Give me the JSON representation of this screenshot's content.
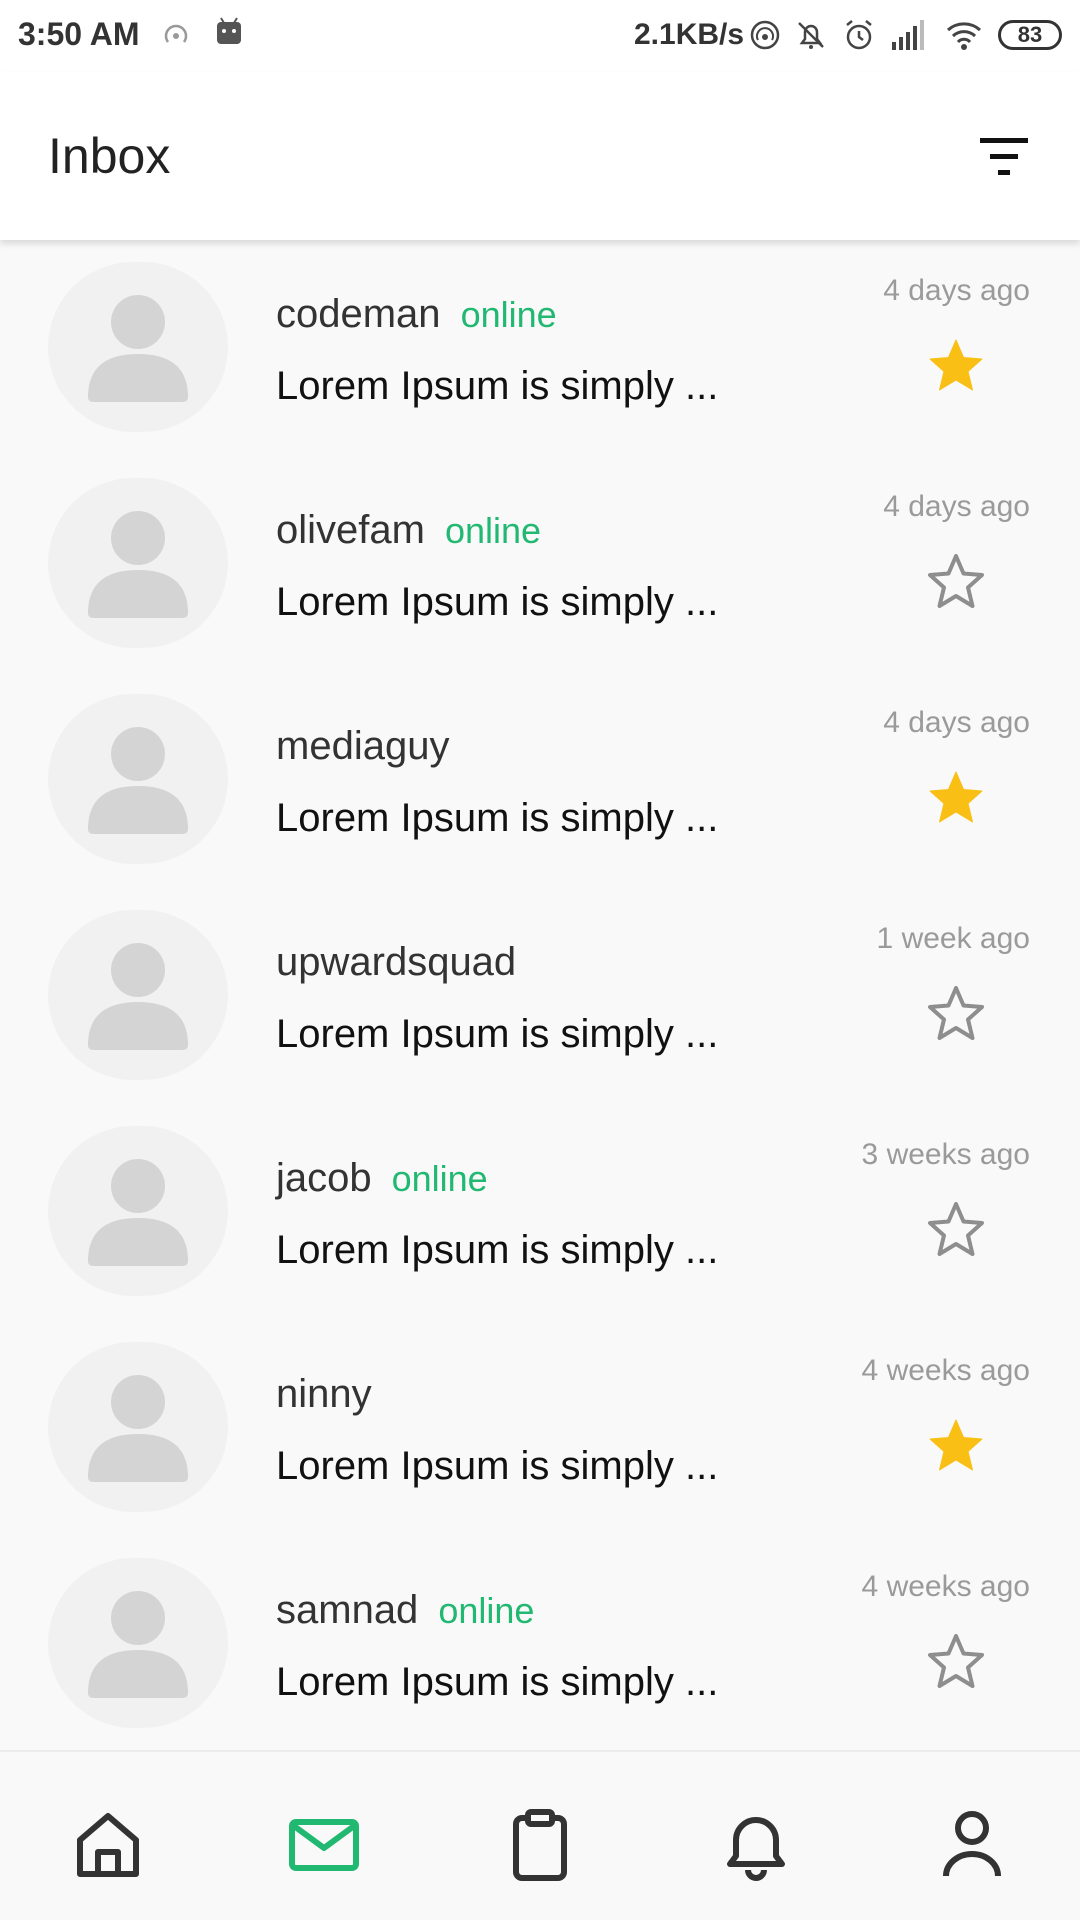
{
  "status_bar": {
    "time": "3:50 AM",
    "network_speed": "2.1KB/s",
    "battery": "83",
    "icons": [
      "hotspot-icon",
      "android-debug-icon",
      "data-sync-icon",
      "mute-icon",
      "alarm-icon",
      "signal-icon",
      "wifi-icon",
      "battery-icon"
    ]
  },
  "header": {
    "title": "Inbox",
    "filter_icon": "filter-icon"
  },
  "colors": {
    "online": "#21b872",
    "star_active": "#f9bf15",
    "star_inactive": "#8e8e8e",
    "nav_active": "#21b872",
    "nav_inactive": "#333333"
  },
  "messages": [
    {
      "username": "codeman",
      "online": "online",
      "preview": "Lorem Ipsum is simply ...",
      "time": "4 days ago",
      "starred": true
    },
    {
      "username": "olivefam",
      "online": "online",
      "preview": "Lorem Ipsum is simply ...",
      "time": "4 days ago",
      "starred": false
    },
    {
      "username": "mediaguy",
      "online": "",
      "preview": "Lorem Ipsum is simply ...",
      "time": "4 days ago",
      "starred": true
    },
    {
      "username": "upwardsquad",
      "online": "",
      "preview": "Lorem Ipsum is simply ...",
      "time": "1 week ago",
      "starred": false
    },
    {
      "username": "jacob",
      "online": "online",
      "preview": "Lorem Ipsum is simply ...",
      "time": "3 weeks ago",
      "starred": false
    },
    {
      "username": "ninny",
      "online": "",
      "preview": "Lorem Ipsum is simply ...",
      "time": "4 weeks ago",
      "starred": true
    },
    {
      "username": "samnad",
      "online": "online",
      "preview": "Lorem Ipsum is simply ...",
      "time": "4 weeks ago",
      "starred": false
    }
  ],
  "bottom_nav": {
    "items": [
      {
        "icon": "home-icon",
        "active": false
      },
      {
        "icon": "mail-icon",
        "active": true
      },
      {
        "icon": "clipboard-icon",
        "active": false
      },
      {
        "icon": "bell-icon",
        "active": false
      },
      {
        "icon": "profile-icon",
        "active": false
      }
    ]
  }
}
